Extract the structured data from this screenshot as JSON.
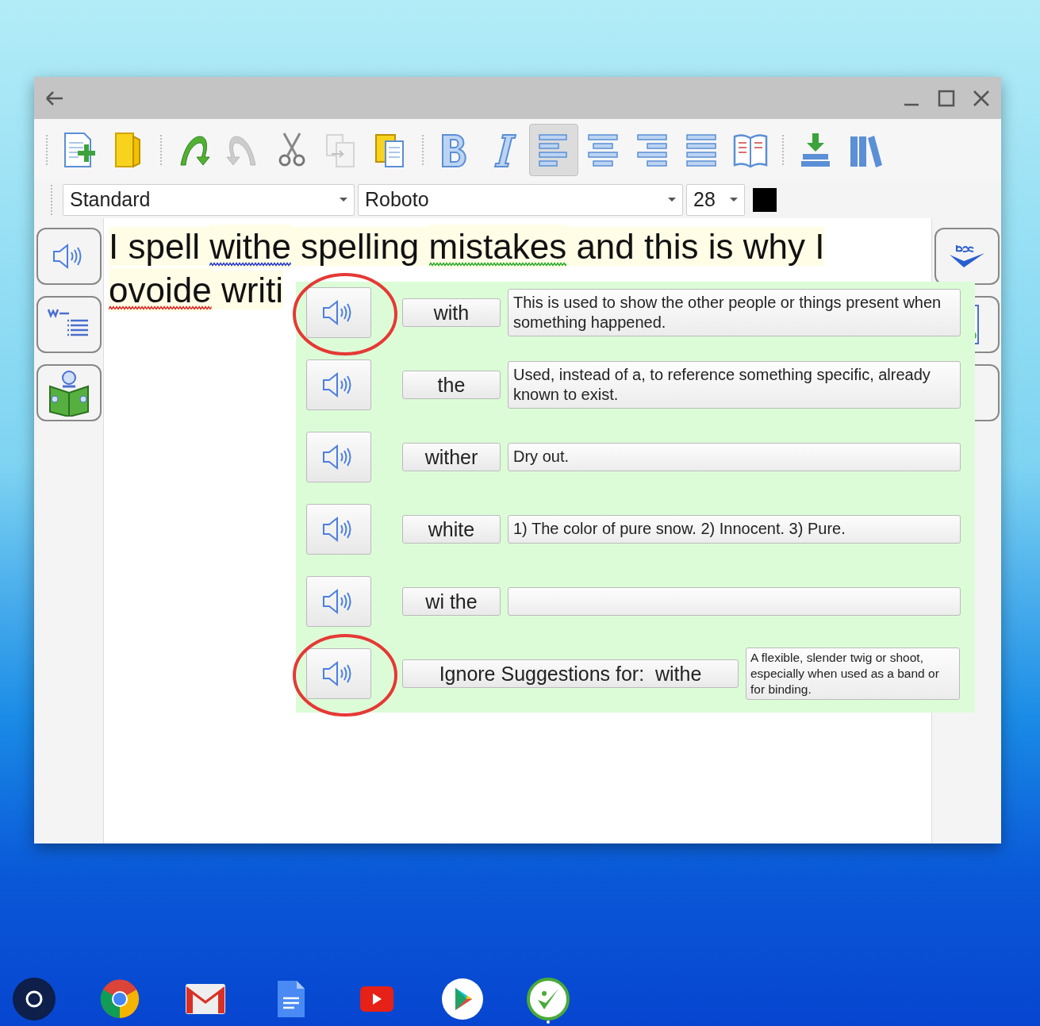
{
  "toolbar": {
    "groups": [
      [
        {
          "kind": "new-doc",
          "selected": false,
          "disabled": false
        },
        {
          "kind": "open-folder",
          "selected": false,
          "disabled": false
        }
      ],
      [
        {
          "kind": "undo",
          "selected": false,
          "disabled": false
        },
        {
          "kind": "redo",
          "selected": false,
          "disabled": true
        },
        {
          "kind": "cut",
          "selected": false,
          "disabled": false
        },
        {
          "kind": "copy",
          "selected": false,
          "disabled": true
        },
        {
          "kind": "paste",
          "selected": false,
          "disabled": false
        }
      ],
      [
        {
          "kind": "bold",
          "selected": false,
          "disabled": false
        },
        {
          "kind": "italic",
          "selected": false,
          "disabled": false
        },
        {
          "kind": "align-left",
          "selected": true,
          "disabled": false
        },
        {
          "kind": "align-center",
          "selected": false,
          "disabled": false
        },
        {
          "kind": "align-right",
          "selected": false,
          "disabled": false
        },
        {
          "kind": "justify",
          "selected": false,
          "disabled": false
        },
        {
          "kind": "book",
          "selected": false,
          "disabled": false
        }
      ],
      [
        {
          "kind": "download",
          "selected": false,
          "disabled": false
        },
        {
          "kind": "library",
          "selected": false,
          "disabled": false
        }
      ]
    ]
  },
  "format_bar": {
    "style": "Standard",
    "font": "Roboto",
    "size": "28",
    "color": "#000000"
  },
  "left_sidebar": [
    {
      "kind": "speak"
    },
    {
      "kind": "word-list"
    },
    {
      "kind": "reader"
    }
  ],
  "right_sidebar": [
    {
      "kind": "spell-check"
    },
    {
      "kind": "document"
    },
    {
      "kind": "blank"
    }
  ],
  "document": {
    "segments": [
      {
        "text": "I spell "
      },
      {
        "text": "withe",
        "color": "#2233cc"
      },
      {
        "text": " spelling "
      },
      {
        "text": "mistakes",
        "color": "#22aa22"
      },
      {
        "text": " and this is why I "
      },
      {
        "text": "ovoide",
        "color": "#dd2222"
      },
      {
        "text": " writi"
      }
    ]
  },
  "suggestions": [
    {
      "kind": "word",
      "word": "with",
      "definition": "This is used to show the other people or things present when something happened.",
      "circled": true
    },
    {
      "kind": "word",
      "word": "the",
      "definition": "Used, instead of a, to reference something specific, already known to exist.",
      "circled": false
    },
    {
      "kind": "word",
      "word": "wither",
      "definition": "Dry out.",
      "circled": false
    },
    {
      "kind": "word",
      "word": "white",
      "definition": "1) The color of pure snow. 2) Innocent. 3) Pure.",
      "circled": false
    },
    {
      "kind": "word",
      "word": "wi the",
      "circled": false
    },
    {
      "kind": "ignore",
      "word": "Ignore Suggestions for:  withe",
      "definition": "A flexible, slender twig or shoot, especially when used as a band or for binding.",
      "circled": true
    }
  ],
  "shelf": [
    {
      "kind": "launcher",
      "running": false
    },
    {
      "kind": "chrome",
      "running": false
    },
    {
      "kind": "mail",
      "running": false
    },
    {
      "kind": "docs",
      "running": false
    },
    {
      "kind": "youtube",
      "running": false
    },
    {
      "kind": "play",
      "running": false
    },
    {
      "kind": "check-app",
      "running": true
    }
  ]
}
